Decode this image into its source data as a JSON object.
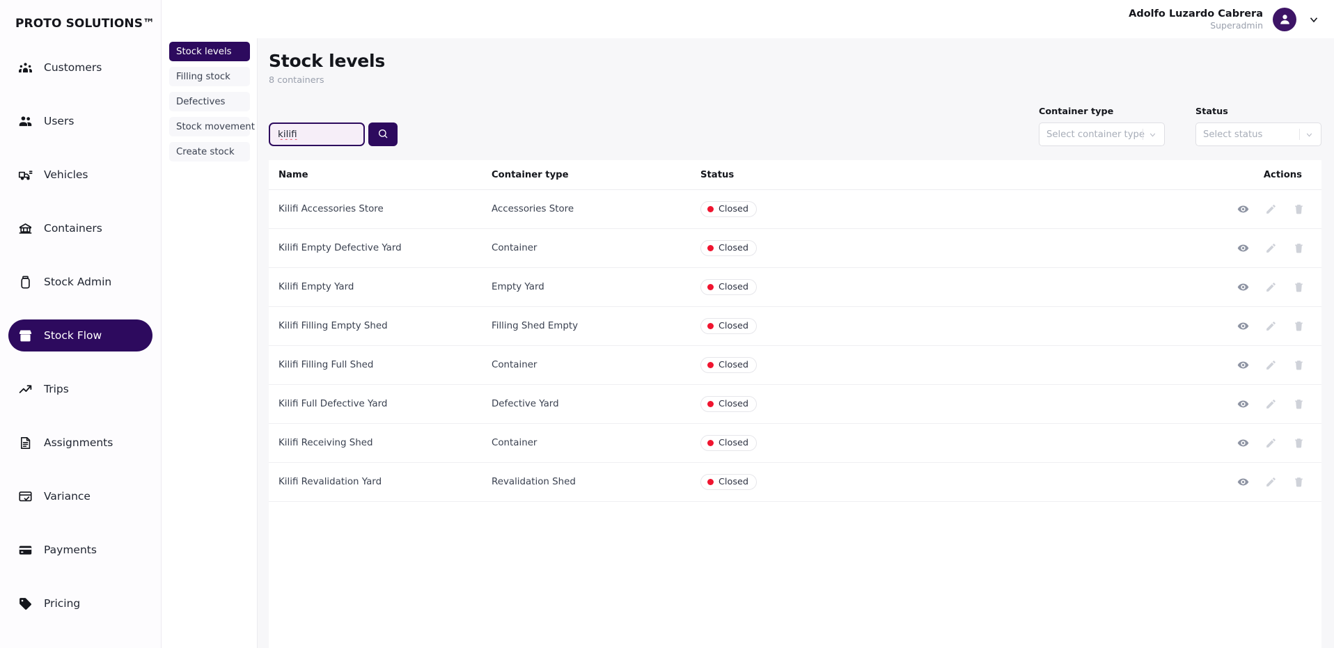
{
  "brand": "PROTO SOLUTIONS™",
  "colors": {
    "primary": "#2d0a5e",
    "avatar": "#3d1466",
    "status_dot": "#f0142f",
    "content_bg": "#f7f7f9",
    "sidebar_bg": "#fdfcfe"
  },
  "sidebar": {
    "items": [
      {
        "label": "Customers",
        "icon": "customers-icon",
        "active": false
      },
      {
        "label": "Users",
        "icon": "users-icon",
        "active": false
      },
      {
        "label": "Vehicles",
        "icon": "vehicles-icon",
        "active": false
      },
      {
        "label": "Containers",
        "icon": "containers-icon",
        "active": false
      },
      {
        "label": "Stock Admin",
        "icon": "stock-admin-icon",
        "active": false
      },
      {
        "label": "Stock Flow",
        "icon": "stock-flow-icon",
        "active": true
      },
      {
        "label": "Trips",
        "icon": "trips-icon",
        "active": false
      },
      {
        "label": "Assignments",
        "icon": "assignments-icon",
        "active": false
      },
      {
        "label": "Variance",
        "icon": "variance-icon",
        "active": false
      },
      {
        "label": "Payments",
        "icon": "payments-icon",
        "active": false
      },
      {
        "label": "Pricing",
        "icon": "pricing-icon",
        "active": false
      }
    ]
  },
  "topbar": {
    "user_name": "Adolfo Luzardo Cabrera",
    "user_role": "Superadmin",
    "avatar_icon": "user-avatar-icon",
    "chevron_icon": "chevron-down-icon"
  },
  "subnav": {
    "items": [
      {
        "label": "Stock levels",
        "active": true
      },
      {
        "label": "Filling stock",
        "active": false
      },
      {
        "label": "Defectives",
        "active": false
      },
      {
        "label": "Stock movement",
        "active": false
      },
      {
        "label": "Create stock",
        "active": false
      }
    ]
  },
  "page": {
    "title": "Stock levels",
    "subtitle": "8 containers"
  },
  "search": {
    "value": "kilifi",
    "placeholder": "",
    "button_icon": "search-icon"
  },
  "filters": {
    "container_type": {
      "label": "Container type",
      "placeholder": "Select container type",
      "value": "",
      "chevron_icon": "chevron-down-icon"
    },
    "status": {
      "label": "Status",
      "placeholder": "Select status",
      "value": "",
      "chevron_icon": "chevron-down-icon"
    }
  },
  "table": {
    "headers": {
      "name": "Name",
      "type": "Container type",
      "status": "Status",
      "actions": "Actions"
    },
    "action_icons": [
      "eye-icon",
      "pencil-icon",
      "trash-icon"
    ],
    "rows": [
      {
        "name": "Kilifi Accessories Store",
        "type": "Accessories Store",
        "status": "Closed"
      },
      {
        "name": "Kilifi Empty Defective Yard",
        "type": "Container",
        "status": "Closed"
      },
      {
        "name": "Kilifi Empty Yard",
        "type": "Empty Yard",
        "status": "Closed"
      },
      {
        "name": "Kilifi Filling Empty Shed",
        "type": "Filling Shed Empty",
        "status": "Closed"
      },
      {
        "name": "Kilifi Filling Full Shed",
        "type": "Container",
        "status": "Closed"
      },
      {
        "name": "Kilifi Full Defective Yard",
        "type": "Defective Yard",
        "status": "Closed"
      },
      {
        "name": "Kilifi Receiving Shed",
        "type": "Container",
        "status": "Closed"
      },
      {
        "name": "Kilifi Revalidation Yard",
        "type": "Revalidation Shed",
        "status": "Closed"
      }
    ]
  }
}
